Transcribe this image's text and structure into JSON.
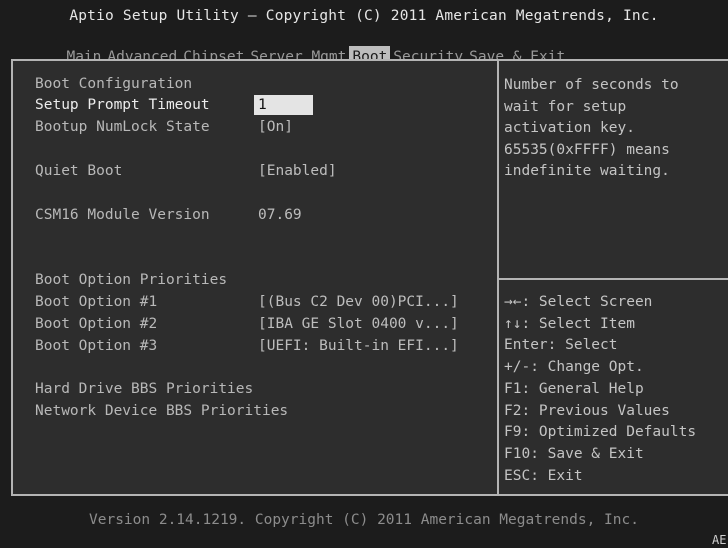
{
  "header": {
    "title": "Aptio Setup Utility – Copyright (C) 2011 American Megatrends, Inc.",
    "tabs": [
      "Main",
      "Advanced",
      "Chipset",
      "Server Mgmt",
      "Boot",
      "Security",
      "Save & Exit"
    ],
    "active_tab": "Boot"
  },
  "main": {
    "boot_config_heading": "Boot Configuration",
    "setup_prompt_label": "Setup Prompt Timeout",
    "setup_prompt_value": "1",
    "numlock_label": "Bootup NumLock State",
    "numlock_value": "[On]",
    "quiet_boot_label": "Quiet Boot",
    "quiet_boot_value": "[Enabled]",
    "csm_label": "CSM16 Module Version",
    "csm_value": "07.69",
    "priorities_heading": "Boot Option Priorities",
    "boot_options": [
      {
        "label": "Boot Option #1",
        "value": "[(Bus C2 Dev 00)PCI...]"
      },
      {
        "label": "Boot Option #2",
        "value": "[IBA GE Slot 0400 v...]"
      },
      {
        "label": "Boot Option #3",
        "value": "[UEFI: Built-in EFI...]"
      }
    ],
    "hdd_bbs_label": "Hard Drive BBS Priorities",
    "net_bbs_label": "Network Device BBS Priorities"
  },
  "help": {
    "lines": [
      "Number of seconds to",
      "wait for setup",
      "activation key.",
      "65535(0xFFFF) means",
      "indefinite waiting."
    ]
  },
  "keys": {
    "lines": [
      "→←: Select Screen",
      "↑↓: Select Item",
      "Enter: Select",
      "+/-: Change Opt.",
      "F1: General Help",
      "F2: Previous Values",
      "F9: Optimized Defaults",
      "F10: Save & Exit",
      "ESC: Exit"
    ]
  },
  "footer": {
    "version": "Version 2.14.1219. Copyright (C) 2011 American Megatrends, Inc.",
    "corner": "AE"
  }
}
